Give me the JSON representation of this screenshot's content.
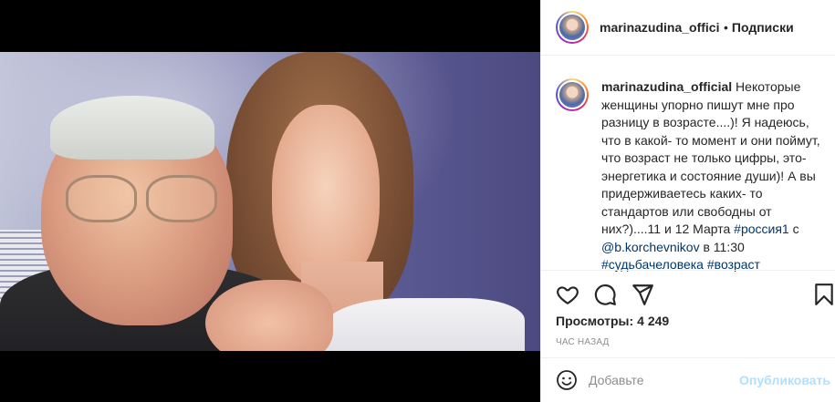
{
  "header": {
    "username": "marinazudina_official",
    "separator": "•",
    "follow_label": "Подписки"
  },
  "caption": {
    "username": "marinazudina_official",
    "text_part1": "Некоторые женщины упорно пишут мне про разницу в возрасте....)! Я надеюсь, что в какой- то момент и они поймут, что возраст не только цифры, это- энергетика и состояние души)! А вы придерживаетесь каких- то стандартов или свободны от них?)....11 и 12 Марта ",
    "hashtag1": "#россия1",
    "text_part2": " с ",
    "mention": "@b.korchevnikov",
    "text_part3": " в 11:30 ",
    "hashtag2": "#судьбачеловека",
    "text_part4": " ",
    "hashtag3": "#возраст"
  },
  "stats": {
    "views_label": "Просмотры:",
    "views_count": "4 249",
    "time": "ЧАС НАЗАД"
  },
  "comment": {
    "placeholder": "Добавьте",
    "publish_label": "Опубликовать"
  },
  "icons": {
    "like": "heart-icon",
    "comment": "comment-icon",
    "share": "paper-plane-icon",
    "save": "bookmark-icon",
    "emoji": "smiley-icon",
    "sound": "speaker-icon"
  },
  "colors": {
    "link": "#00376b",
    "publish_disabled": "#b2dffc",
    "muted": "#8e8e8e"
  }
}
